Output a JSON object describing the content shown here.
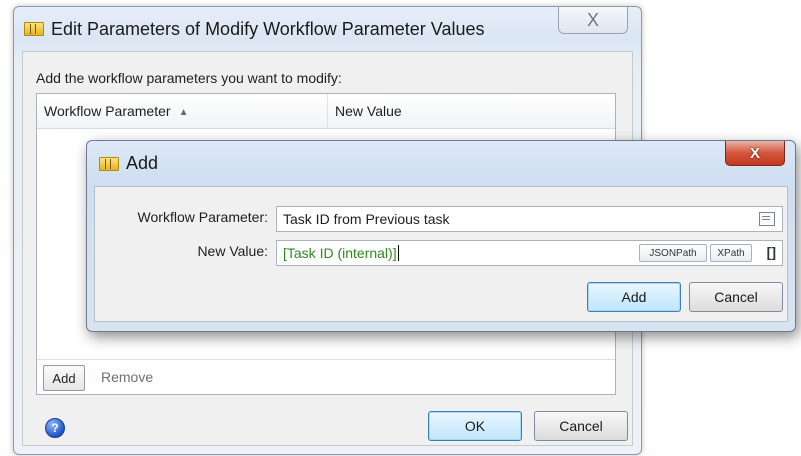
{
  "outer_dialog": {
    "title": "Edit Parameters of Modify Workflow Parameter Values",
    "close_glyph": "X",
    "prompt": "Add the workflow parameters you want to modify:",
    "table": {
      "columns": [
        "Workflow Parameter",
        "New Value"
      ],
      "sort_indicator": "▲",
      "rows": []
    },
    "add_label": "Add",
    "remove_label": "Remove",
    "help_glyph": "?",
    "ok_label": "OK",
    "cancel_label": "Cancel"
  },
  "add_dialog": {
    "title": "Add",
    "close_glyph": "X",
    "workflow_parameter_label": "Workflow Parameter:",
    "workflow_parameter_value": "Task ID from Previous task",
    "new_value_label": "New Value:",
    "new_value_value": "[Task ID (internal)]",
    "jsonpath_label": "JSONPath",
    "xpath_label": "XPath",
    "brackets_label": "[]",
    "add_label": "Add",
    "cancel_label": "Cancel"
  },
  "colors": {
    "accent_button": "#bee6fd",
    "variable_text": "#2e8b1e",
    "close_button_red": "#c2391f"
  },
  "icons": [
    "app-icon",
    "sort-ascending-icon",
    "help-icon",
    "list-picker-icon",
    "close-icon"
  ]
}
